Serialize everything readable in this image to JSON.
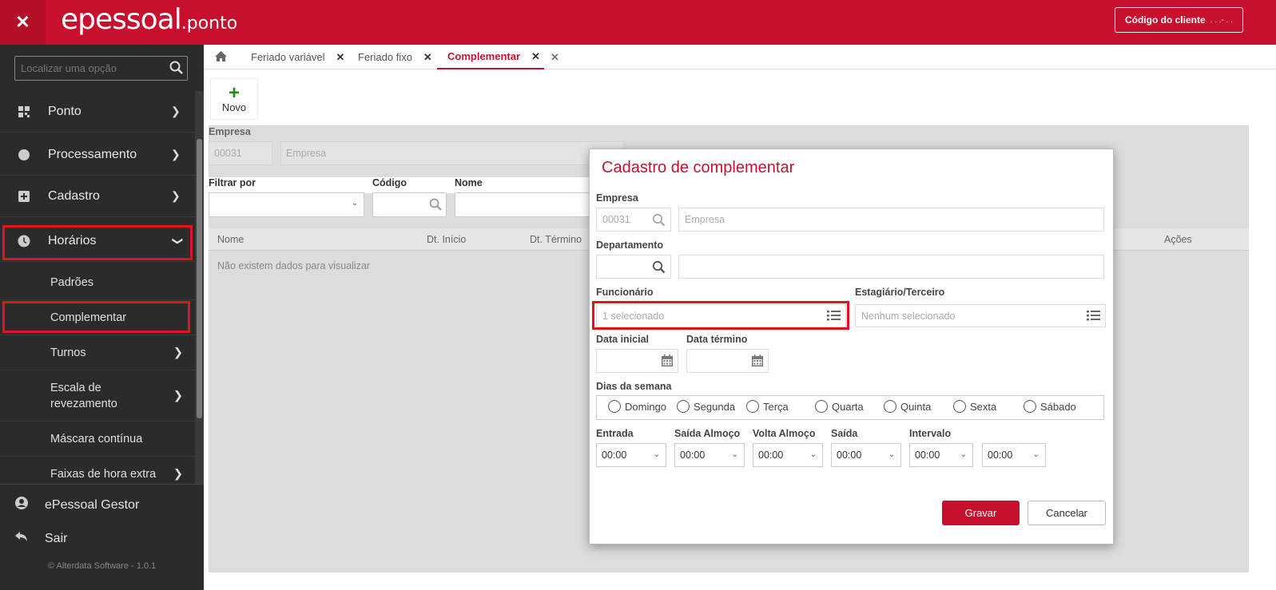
{
  "topbar": {
    "logo_main": "epessoal",
    "logo_sub": ".ponto",
    "client_button": "Código do cliente",
    "client_code": ". . .- . ."
  },
  "sidebar": {
    "search_placeholder": "Localizar uma opção",
    "items": [
      {
        "label": "Ponto",
        "icon": "qr-grid-icon"
      },
      {
        "label": "Processamento",
        "icon": "circle-icon"
      },
      {
        "label": "Cadastro",
        "icon": "plus-square-icon"
      },
      {
        "label": "Horários",
        "icon": "clock-icon",
        "expanded": true
      }
    ],
    "subitems": [
      {
        "label": "Padrões"
      },
      {
        "label": "Complementar",
        "selected": true
      },
      {
        "label": "Turnos"
      },
      {
        "label": "Escala de revezamento"
      },
      {
        "label": "Máscara contínua"
      },
      {
        "label": "Faixas de hora extra"
      }
    ],
    "bottom": {
      "gestor": "ePessoal Gestor",
      "sair": "Sair",
      "copyright": "© Alterdata Software - 1.0.1"
    }
  },
  "tabs": [
    {
      "label": "Feriado variável"
    },
    {
      "label": "Feriado fixo"
    },
    {
      "label": "Complementar",
      "active": true
    }
  ],
  "toolbar": {
    "novo": "Novo"
  },
  "background_form": {
    "empresa_label": "Empresa",
    "empresa_code": "00031",
    "empresa_placeholder": "Empresa",
    "filtrar_label": "Filtrar por",
    "codigo_label": "Código",
    "nome_label": "Nome",
    "columns": [
      "Nome",
      "Dt. Início",
      "Dt. Término",
      "Ações"
    ],
    "no_data": "Não existem dados para visualizar"
  },
  "modal": {
    "title": "Cadastro de complementar",
    "empresa_label": "Empresa",
    "empresa_code": "00031",
    "empresa_placeholder": "Empresa",
    "departamento_label": "Departamento",
    "funcionario_label": "Funcionário",
    "funcionario_value": "1 selecionado",
    "estagiario_label": "Estagiário/Terceiro",
    "estagiario_value": "Nenhum selecionado",
    "data_inicial_label": "Data inicial",
    "data_termino_label": "Data término",
    "dias_label": "Dias da semana",
    "days": [
      "Domingo",
      "Segunda",
      "Terça",
      "Quarta",
      "Quinta",
      "Sexta",
      "Sábado"
    ],
    "time_labels": [
      "Entrada",
      "Saída Almoço",
      "Volta Almoço",
      "Saída",
      "Intervalo"
    ],
    "time_values": [
      "00:00",
      "00:00",
      "00:00",
      "00:00",
      "00:00",
      "00:00"
    ],
    "gravar": "Gravar",
    "cancelar": "Cancelar"
  },
  "colors": {
    "brand": "#c8102e",
    "sidebar": "#2b2b2b",
    "highlight": "#e4111f"
  }
}
